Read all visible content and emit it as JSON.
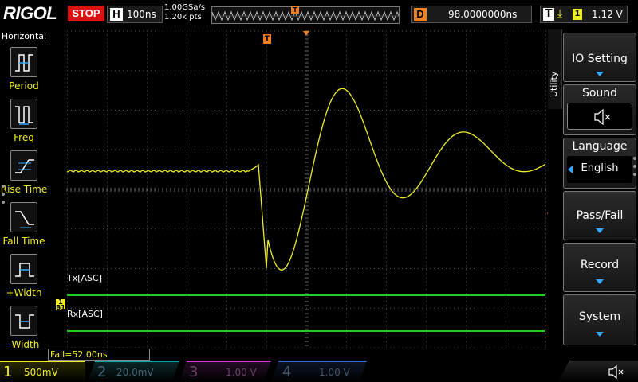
{
  "header": {
    "brand": "RIGOL",
    "run_state": "STOP",
    "timebase_label": "H",
    "timebase_value": "100ns",
    "sample_rate": "1.00GSa/s",
    "memory_depth": "1.20k pts",
    "delay_label": "D",
    "delay_value": "98.0000000ns",
    "trigger_label": "T",
    "trigger_channel": "1",
    "trigger_level": "1.12 V"
  },
  "left_menu": {
    "title": "Horizontal",
    "items": [
      {
        "label": "Period",
        "icon": "period-icon"
      },
      {
        "label": "Freq",
        "icon": "freq-icon"
      },
      {
        "label": "Rise Time",
        "icon": "rise-time-icon"
      },
      {
        "label": "Fall Time",
        "icon": "fall-time-icon"
      },
      {
        "label": "+Width",
        "icon": "pos-width-icon"
      },
      {
        "label": "-Width",
        "icon": "neg-width-icon"
      }
    ]
  },
  "scope": {
    "trigger_marker": "T",
    "decode1_label": "Tx[ASC]",
    "decode2_label": "Rx[ASC]",
    "ch1_marker": "1",
    "ch1_marker_sub": "B1"
  },
  "measurement": "Fall=52.00ns",
  "right_menu": {
    "tab": "Utility",
    "items": [
      {
        "label": "IO Setting"
      },
      {
        "label": "Sound"
      },
      {
        "label": "Language",
        "value": "English"
      },
      {
        "label": "Pass/Fail"
      },
      {
        "label": "Record"
      },
      {
        "label": "System"
      }
    ]
  },
  "channels": [
    {
      "num": "1",
      "scale": "500mV"
    },
    {
      "num": "2",
      "scale": "20.0mV"
    },
    {
      "num": "3",
      "scale": "1.00 V"
    },
    {
      "num": "4",
      "scale": "1.00 V"
    }
  ],
  "colors": {
    "ch1": "#eeee22",
    "decode_bus": "#22cc22",
    "trigger": "#f08020",
    "menu_accent": "#33aaff"
  }
}
